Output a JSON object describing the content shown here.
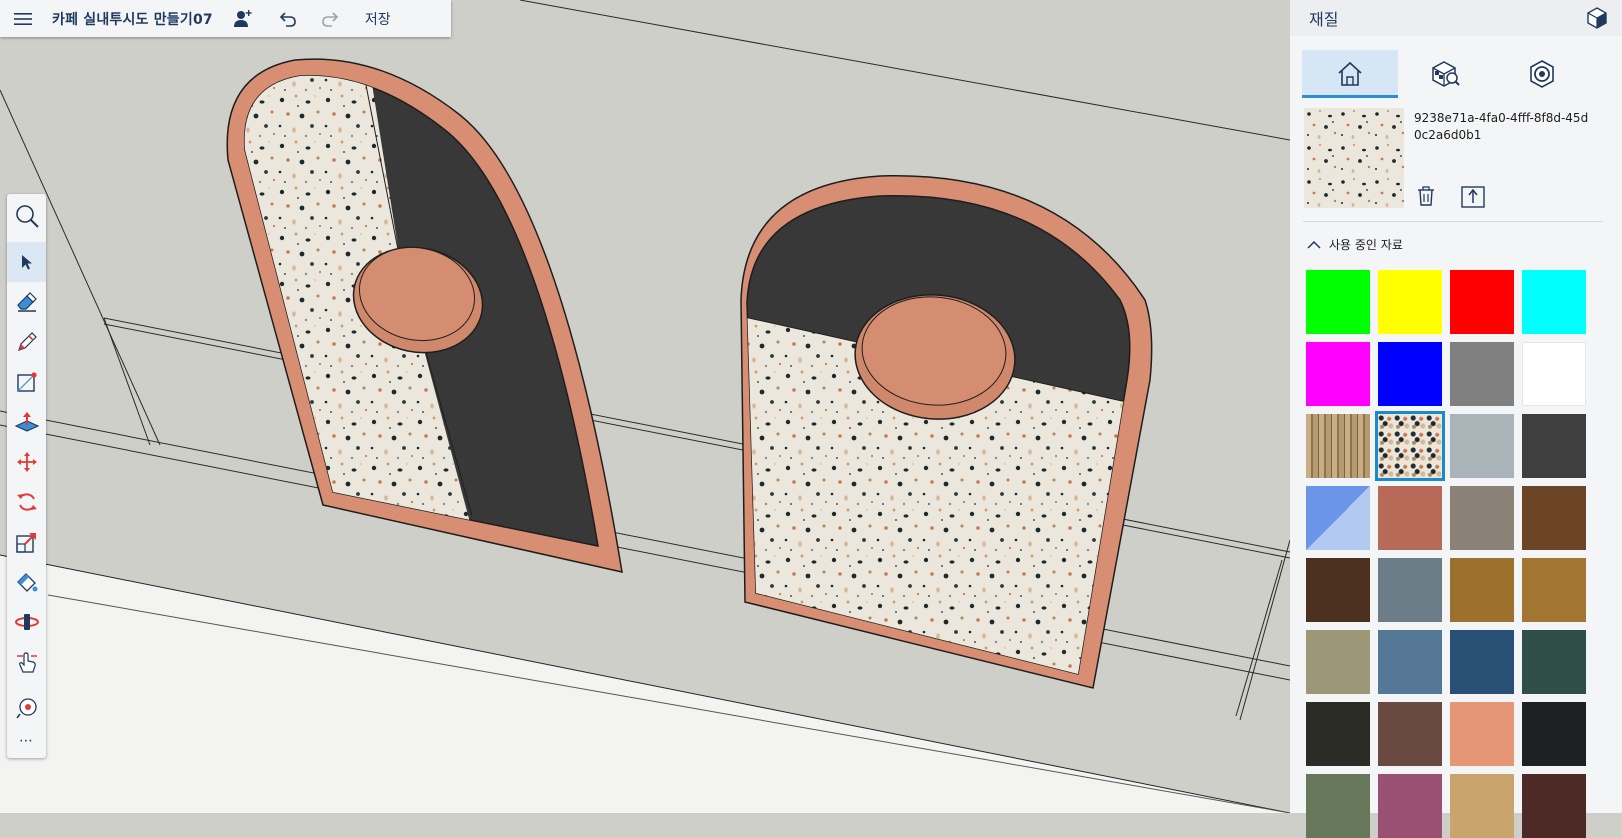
{
  "toolbar": {
    "menu_icon": "hamburger-menu-icon",
    "title": "카페 실내투시도 만들기07",
    "save_label": "저장"
  },
  "tools": [
    {
      "name": "search-tool",
      "icon": "magnifier-icon"
    },
    {
      "name": "select-tool",
      "icon": "arrow-cursor-icon",
      "active": true
    },
    {
      "name": "eraser-tool",
      "icon": "eraser-icon"
    },
    {
      "name": "pencil-tool",
      "icon": "pencil-icon"
    },
    {
      "name": "shape-tool",
      "icon": "rectangle-draw-icon"
    },
    {
      "name": "push-pull-tool",
      "icon": "push-pull-icon"
    },
    {
      "name": "move-tool",
      "icon": "move-arrows-icon"
    },
    {
      "name": "rotate-tool",
      "icon": "rotate-icon"
    },
    {
      "name": "scale-tool",
      "icon": "scale-icon"
    },
    {
      "name": "paint-bucket-tool",
      "icon": "paint-bucket-icon"
    },
    {
      "name": "orbit-tool",
      "icon": "orbit-icon"
    },
    {
      "name": "pan-tool",
      "icon": "hand-icon"
    },
    {
      "name": "tape-measure-tool",
      "icon": "tape-measure-icon"
    }
  ],
  "tools_more_label": "⋯",
  "panel": {
    "title": "재질",
    "tabs": [
      "home-tab",
      "browse-materials-tab",
      "edit-material-tab"
    ],
    "material_name": "9238e71a-4fa0-4fff-8f8d-45d0c2a6d0b1",
    "section_label": "사용 중인 자료",
    "swatches": [
      {
        "color": "#00ff00"
      },
      {
        "color": "#ffff00"
      },
      {
        "color": "#ff0000"
      },
      {
        "color": "#00ffff"
      },
      {
        "color": "#ff00ff"
      },
      {
        "color": "#0000ff"
      },
      {
        "color": "#808080"
      },
      {
        "color": "#ffffff"
      },
      {
        "color": "#b49a72",
        "texture": "wood-slats"
      },
      {
        "color": "#ebe7dd",
        "texture": "terrazzo",
        "selected": true
      },
      {
        "color": "#aab3b8"
      },
      {
        "color": "#3f3f3f"
      },
      {
        "color": "#6b96e8",
        "texture": "split"
      },
      {
        "color": "#b86a58"
      },
      {
        "color": "#8a8277"
      },
      {
        "color": "#6b4526"
      },
      {
        "color": "#4d3120"
      },
      {
        "color": "#6d7d87"
      },
      {
        "color": "#9c712d"
      },
      {
        "color": "#a17532"
      },
      {
        "color": "#9b9777"
      },
      {
        "color": "#557897"
      },
      {
        "color": "#2b5075"
      },
      {
        "color": "#2f4e46"
      },
      {
        "color": "#2b2c25"
      },
      {
        "color": "#6a4942"
      },
      {
        "color": "#e59775"
      },
      {
        "color": "#1f2021"
      },
      {
        "color": "#67775a"
      },
      {
        "color": "#9a5072"
      },
      {
        "color": "#c9a56d"
      },
      {
        "color": "#4d2a26"
      }
    ]
  },
  "colors": {
    "accent": "#2b8fd0",
    "frame_copper": "#d88e72",
    "terrazzo_base": "#ebe7dd",
    "dark_panel": "#383838",
    "wall": "#cfcfca"
  }
}
